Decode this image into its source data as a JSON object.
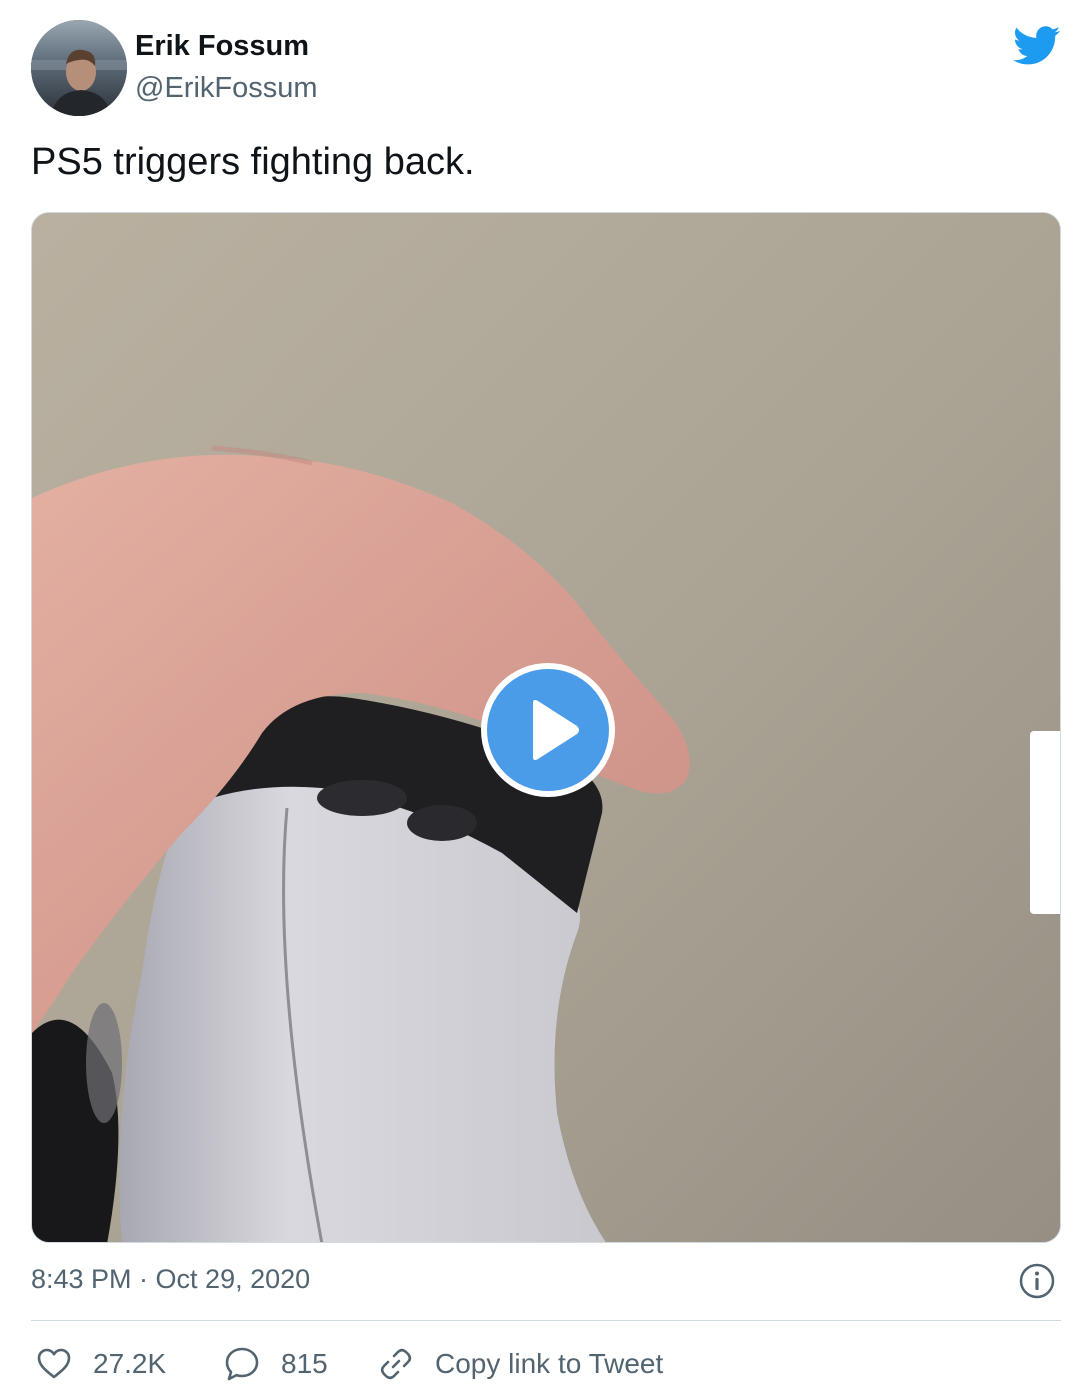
{
  "author": {
    "name": "Erik Fossum",
    "handle": "@ErikFossum",
    "avatar": "avatar-photo"
  },
  "brand": {
    "logo_icon": "twitter-bird-icon",
    "accent_color": "#1d9bf0"
  },
  "tweet": {
    "text": "PS5 triggers fighting back."
  },
  "media": {
    "type": "video",
    "play_icon": "play-icon",
    "play_color": "#4a9be8"
  },
  "footer": {
    "timestamp": "8:43 PM · Oct 29, 2020",
    "info_icon": "info-icon"
  },
  "actions": {
    "like": {
      "icon": "heart-icon",
      "count": "27.2K"
    },
    "reply": {
      "icon": "speech-bubble-icon",
      "count": "815"
    },
    "copy": {
      "icon": "link-icon",
      "label": "Copy link to Tweet"
    }
  }
}
